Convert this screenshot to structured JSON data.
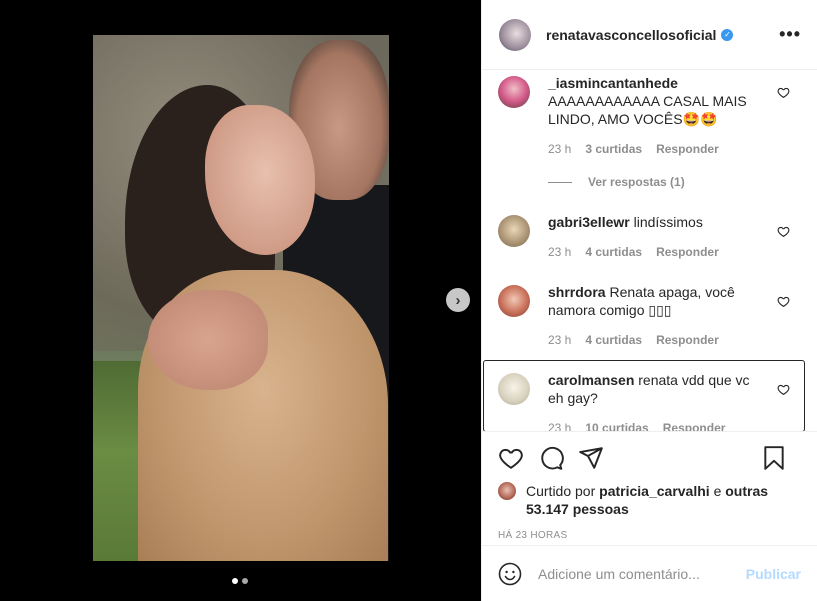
{
  "post": {
    "owner": "renatavasconcellosoficial",
    "more_label": "•••",
    "verified_glyph": "✓"
  },
  "media": {
    "next_arrow": "›",
    "carousel_count": 2,
    "carousel_active_index": 0
  },
  "comments": [
    {
      "username": "_iasmincantanhede",
      "text": "AAAAAAAAAAAA CASAL MAIS LINDO, AMO VOCÊS🤩🤩",
      "time": "23 h",
      "likes": "3 curtidas",
      "reply": "Responder",
      "view_replies": "Ver respostas (1)"
    },
    {
      "username": "gabri3ellewr",
      "text": "lindíssimos",
      "time": "23 h",
      "likes": "4 curtidas",
      "reply": "Responder"
    },
    {
      "username": "shrrdora",
      "text": "Renata apaga, você namora comigo ▯▯▯",
      "time": "23 h",
      "likes": "4 curtidas",
      "reply": "Responder"
    },
    {
      "username": "carolmansen",
      "text": "renata vdd que vc eh gay?",
      "time": "23 h",
      "likes": "10 curtidas",
      "reply": "Responder"
    }
  ],
  "likes": {
    "prefix": "Curtido por",
    "first_liker": "patricia_carvalhi",
    "conjunction": "e",
    "others": "outras 53.147 pessoas",
    "time": "HÁ 23 HORAS"
  },
  "add_comment": {
    "placeholder": "Adicione um comentário...",
    "publish": "Publicar"
  },
  "icons": {
    "like": "heart-icon",
    "comment": "comment-bubble-icon",
    "share": "paper-plane-icon",
    "save": "bookmark-icon",
    "emoji": "smiley-icon"
  },
  "colors": {
    "verified": "#3897f0",
    "publish_disabled": "#b3dbff",
    "secondary_text": "#8e8e8e"
  }
}
